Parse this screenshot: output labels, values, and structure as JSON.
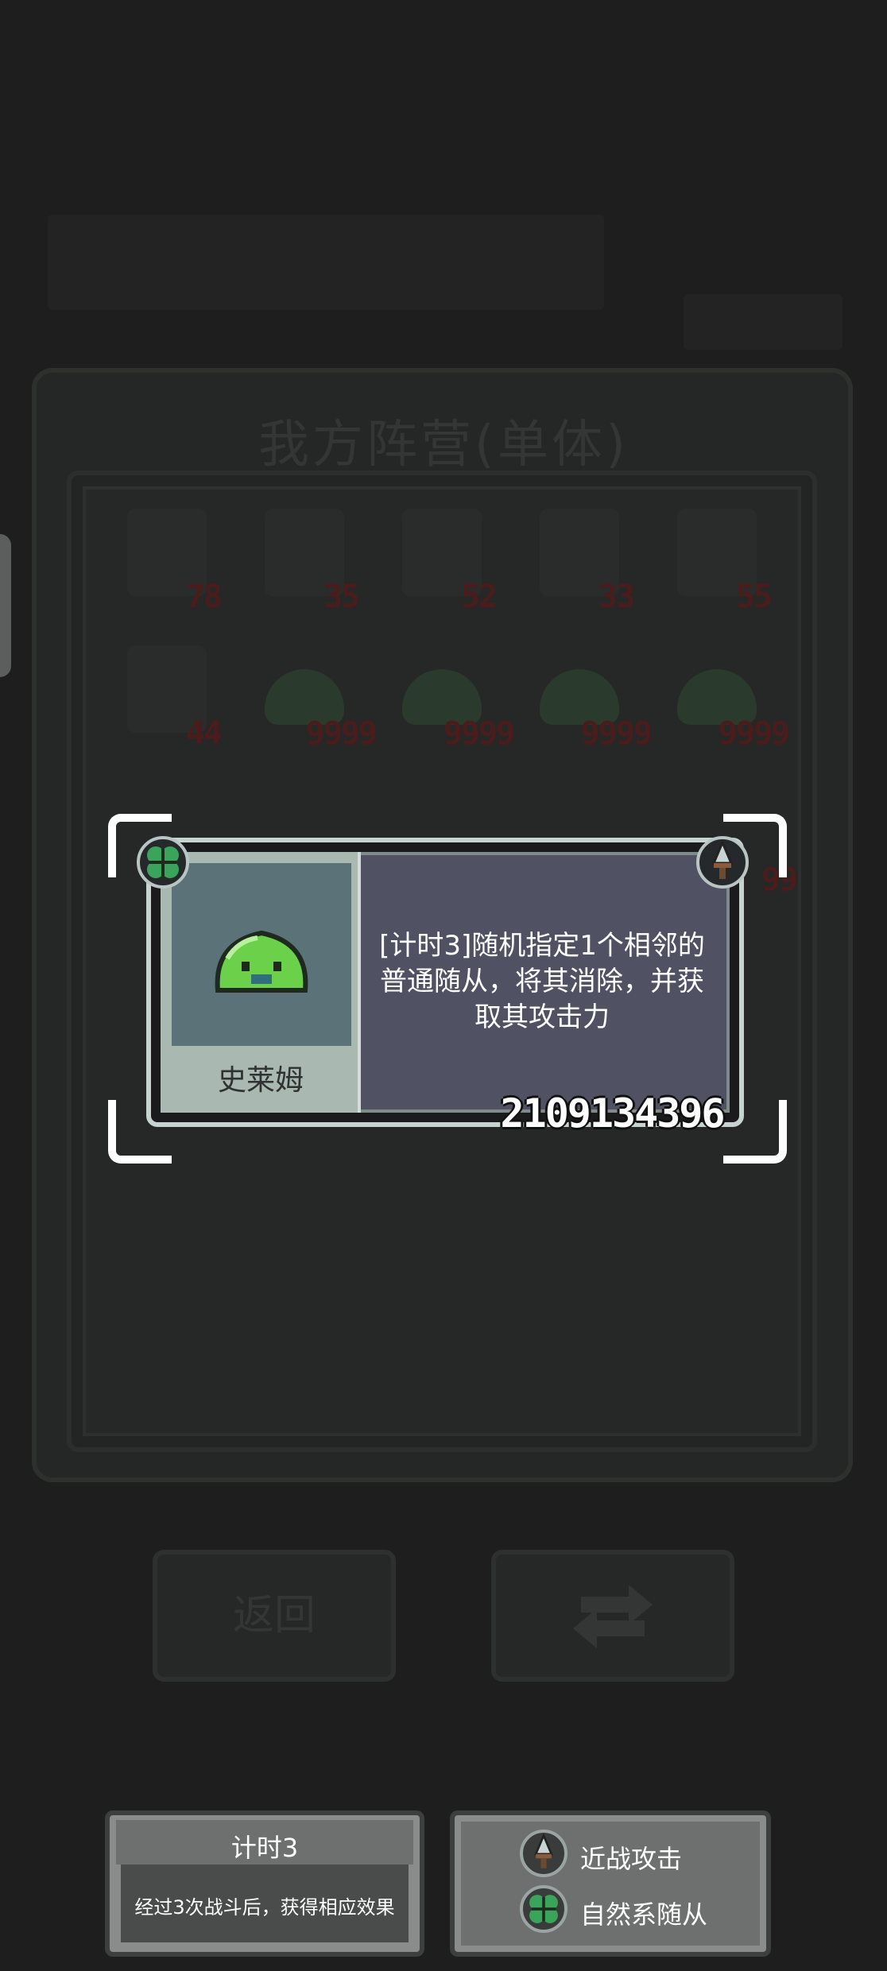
{
  "panel": {
    "title": "我方阵营(单体)"
  },
  "units": {
    "row1": [
      "78",
      "35",
      "52",
      "33",
      "55"
    ],
    "row2": [
      "44",
      "9999",
      "9999",
      "9999",
      "9999"
    ],
    "row3_last": "99"
  },
  "buttons": {
    "back_label": "返回",
    "swap_icon": "swap-arrows-icon"
  },
  "card": {
    "name": "史莱姆",
    "description": "[计时3]随机指定1个相邻的普通随从，将其消除，并获取其攻击力",
    "attack_value": "2109134396",
    "type_badge_icon": "clover-icon",
    "attack_badge_icon": "dagger-icon"
  },
  "info_timer": {
    "title": "计时3",
    "description": "经过3次战斗后，获得相应效果"
  },
  "info_legend": {
    "items": [
      {
        "icon": "dagger-icon",
        "label": "近战攻击"
      },
      {
        "icon": "clover-icon",
        "label": "自然系随从"
      }
    ]
  },
  "colors": {
    "background": "#1e1e1f",
    "card_panel": "#505263",
    "slime_green": "#6bd04a",
    "clover_green": "#3aa55a",
    "attack_red": "#4a1c1c"
  }
}
